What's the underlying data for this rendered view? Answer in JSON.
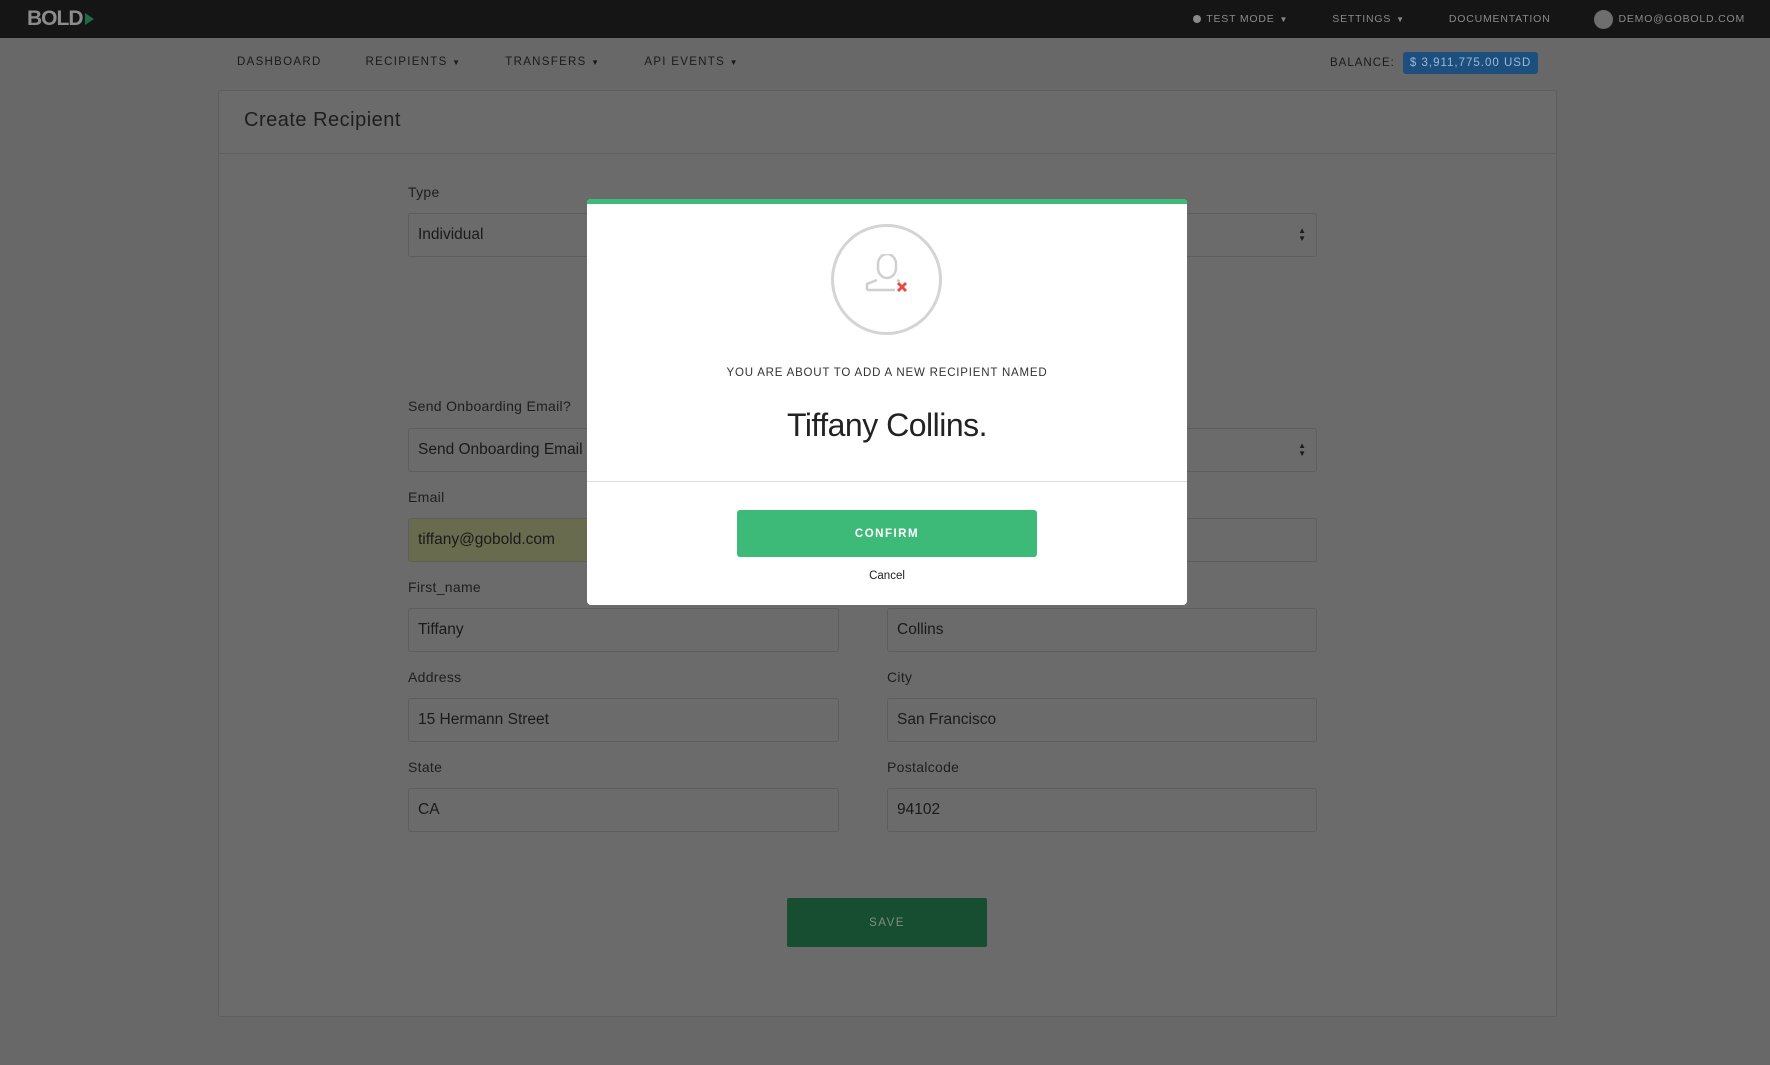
{
  "app": {
    "logo": "BOLD"
  },
  "topnav": {
    "test_mode": "TEST MODE",
    "settings": "SETTINGS",
    "documentation": "DOCUMENTATION",
    "user": "DEMO@GOBOLD.COM"
  },
  "subnav": {
    "dashboard": "DASHBOARD",
    "recipients": "RECIPIENTS",
    "transfers": "TRANSFERS",
    "api_events": "API EVENTS",
    "balance_label": "BALANCE:",
    "balance_value": "$ 3,911,775.00  USD"
  },
  "panel": {
    "title": "Create Recipient"
  },
  "form": {
    "type_label": "Type",
    "type_value": "Individual",
    "onboarding_label": "Send Onboarding Email?",
    "onboarding_value": "Send Onboarding Email",
    "email_label": "Email",
    "email_value": "tiffany@gobold.com",
    "first_name_label": "First_name",
    "first_name_value": "Tiffany",
    "last_name_value": "Collins",
    "address_label": "Address",
    "address_value": "15 Hermann Street",
    "city_label": "City",
    "city_value": "San Francisco",
    "state_label": "State",
    "state_value": "CA",
    "postalcode_label": "Postalcode",
    "postalcode_value": "94102",
    "save_label": "SAVE"
  },
  "modal": {
    "message": "YOU ARE ABOUT TO ADD A NEW RECIPIENT NAMED",
    "name": "Tiffany Collins.",
    "confirm_label": "CONFIRM",
    "cancel_label": "Cancel",
    "icon": "user-remove-icon"
  },
  "colors": {
    "accent": "#3dba78",
    "balance_badge": "#2d84d6",
    "icon_x": "#e84a4a"
  }
}
